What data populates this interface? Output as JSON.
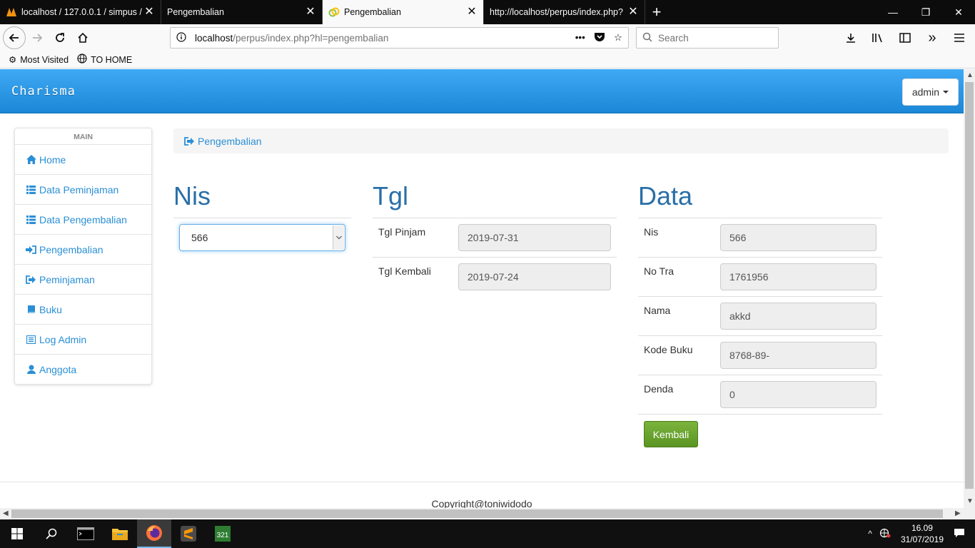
{
  "browser": {
    "tabs": [
      {
        "title": "localhost / 127.0.0.1 / simpus /",
        "active": false
      },
      {
        "title": "Pengembalian",
        "active": false
      },
      {
        "title": "Pengembalian",
        "active": true
      },
      {
        "title": "http://localhost/perpus/index.php?",
        "active": false
      }
    ],
    "url_host": "localhost",
    "url_path": "/perpus/index.php?hl=pengembalian",
    "search_placeholder": "Search",
    "bookmarks": [
      "Most Visited",
      "TO HOME"
    ]
  },
  "app": {
    "brand": "Charisma",
    "user_menu": "admin"
  },
  "sidebar": {
    "header": "MAIN",
    "items": [
      {
        "label": "Home",
        "icon": "home-icon"
      },
      {
        "label": "Data Peminjaman",
        "icon": "list-icon"
      },
      {
        "label": "Data Pengembalian",
        "icon": "list-icon"
      },
      {
        "label": "Pengembalian",
        "icon": "sign-in-icon"
      },
      {
        "label": "Peminjaman",
        "icon": "sign-out-icon"
      },
      {
        "label": "Buku",
        "icon": "book-icon"
      },
      {
        "label": "Log Admin",
        "icon": "list-alt-icon"
      },
      {
        "label": "Anggota",
        "icon": "user-icon"
      }
    ]
  },
  "breadcrumb": "Pengembalian",
  "nis_section": {
    "title": "Nis",
    "selected": "566"
  },
  "tgl_section": {
    "title": "Tgl",
    "rows": [
      {
        "label": "Tgl Pinjam",
        "value": "2019-07-31"
      },
      {
        "label": "Tgl Kembali",
        "value": "2019-07-24"
      }
    ]
  },
  "data_section": {
    "title": "Data",
    "rows": [
      {
        "label": "Nis",
        "value": "566"
      },
      {
        "label": "No Tra",
        "value": "1761956"
      },
      {
        "label": "Nama",
        "value": "akkd"
      },
      {
        "label": "Kode Buku",
        "value": "8768-89-"
      },
      {
        "label": "Denda",
        "value": "0"
      }
    ],
    "submit_label": "Kembali"
  },
  "footer": "Copyright@toniwidodo",
  "taskbar": {
    "time": "16.09",
    "date": "31/07/2019"
  },
  "colors": {
    "topbar": "#1b87d6",
    "link": "#2a8fd6",
    "heading": "#2a6fa8",
    "submit": "#5a9422"
  }
}
